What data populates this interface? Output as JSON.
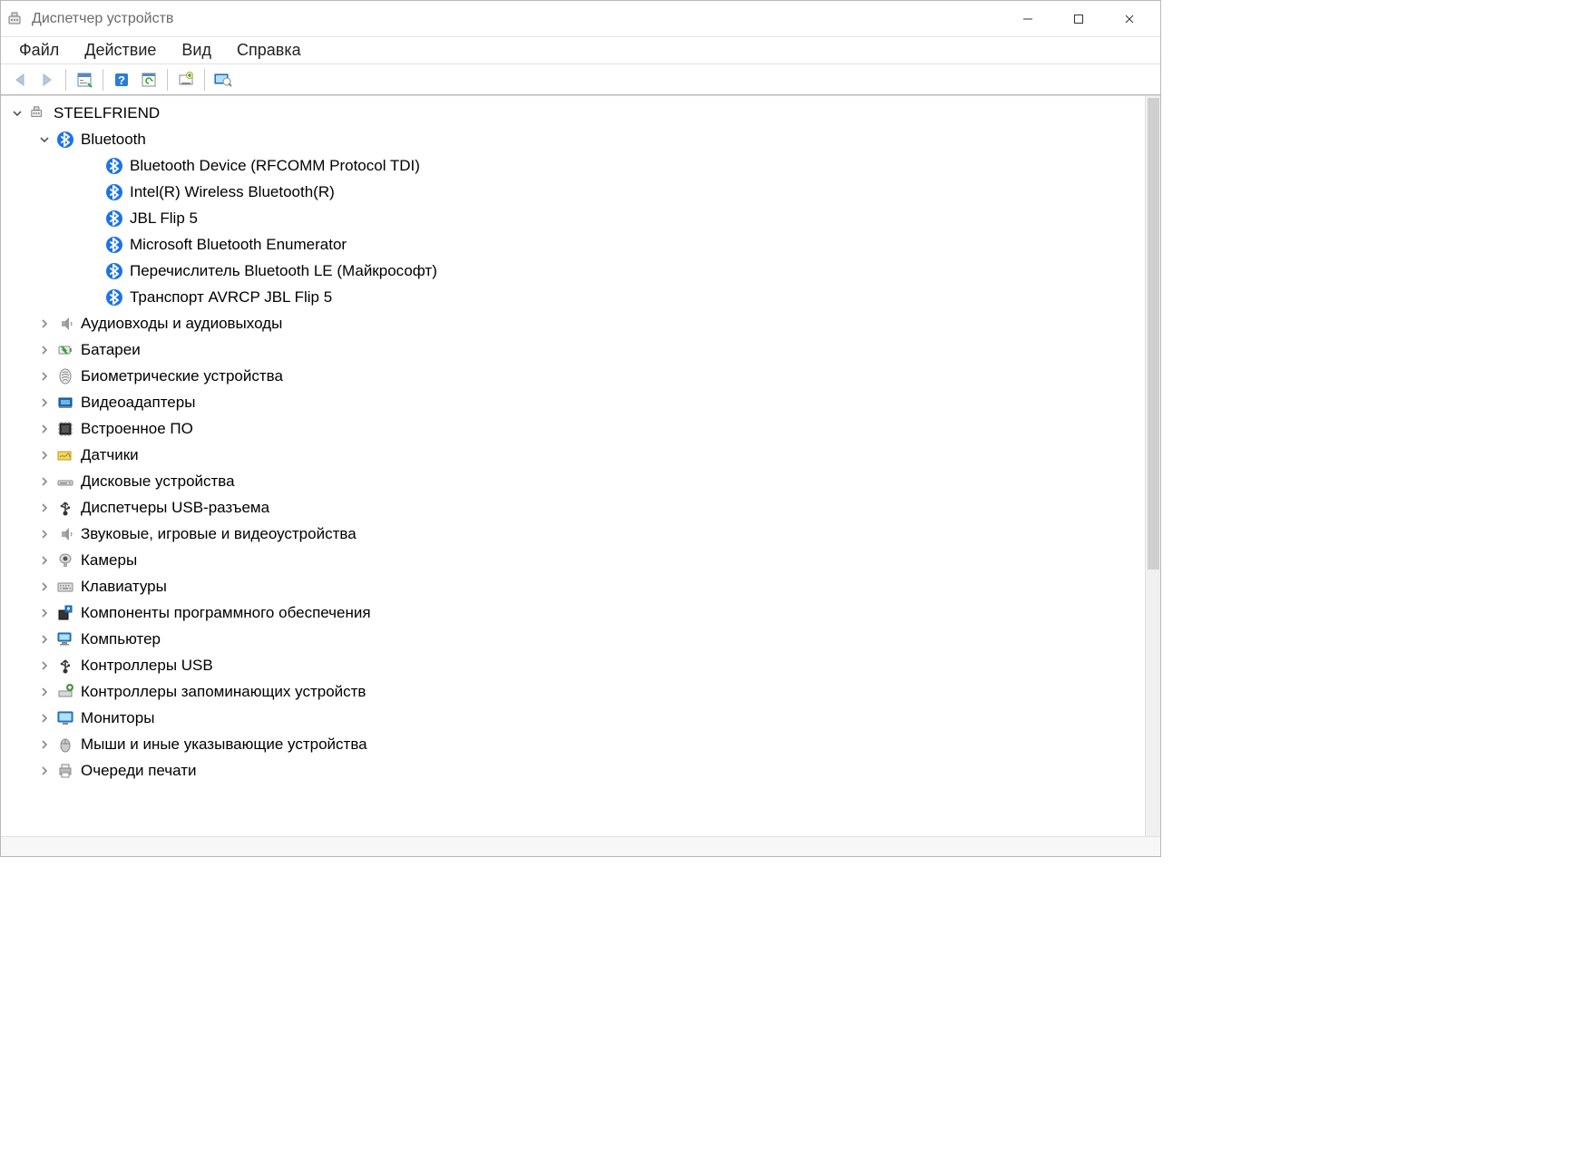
{
  "window": {
    "title": "Диспетчер устройств"
  },
  "menu": {
    "file": "Файл",
    "action": "Действие",
    "view": "Вид",
    "help": "Справка"
  },
  "tree": {
    "root": "STEELFRIEND",
    "bluetooth": {
      "label": "Bluetooth",
      "children": [
        "Bluetooth Device (RFCOMM Protocol TDI)",
        "Intel(R) Wireless Bluetooth(R)",
        "JBL Flip 5",
        "Microsoft Bluetooth Enumerator",
        "Перечислитель Bluetooth LE (Майкрософт)",
        "Транспорт AVRCP JBL Flip 5"
      ]
    },
    "categories": [
      {
        "icon": "audio-inout",
        "label": "Аудиовходы и аудиовыходы"
      },
      {
        "icon": "battery",
        "label": "Батареи"
      },
      {
        "icon": "biometric",
        "label": "Биометрические устройства"
      },
      {
        "icon": "display-adapter",
        "label": "Видеоадаптеры"
      },
      {
        "icon": "firmware",
        "label": "Встроенное ПО"
      },
      {
        "icon": "sensors",
        "label": "Датчики"
      },
      {
        "icon": "disk",
        "label": "Дисковые устройства"
      },
      {
        "icon": "usb-manager",
        "label": "Диспетчеры USB-разъема"
      },
      {
        "icon": "sound-game",
        "label": "Звуковые, игровые и видеоустройства"
      },
      {
        "icon": "camera",
        "label": "Камеры"
      },
      {
        "icon": "keyboard",
        "label": "Клавиатуры"
      },
      {
        "icon": "software-comp",
        "label": "Компоненты программного обеспечения"
      },
      {
        "icon": "computer",
        "label": "Компьютер"
      },
      {
        "icon": "usb-ctrl",
        "label": "Контроллеры USB"
      },
      {
        "icon": "storage-ctrl",
        "label": "Контроллеры запоминающих устройств"
      },
      {
        "icon": "monitor",
        "label": "Мониторы"
      },
      {
        "icon": "mouse",
        "label": "Мыши и иные указывающие устройства"
      },
      {
        "icon": "print-queue",
        "label": "Очереди печати"
      }
    ]
  }
}
